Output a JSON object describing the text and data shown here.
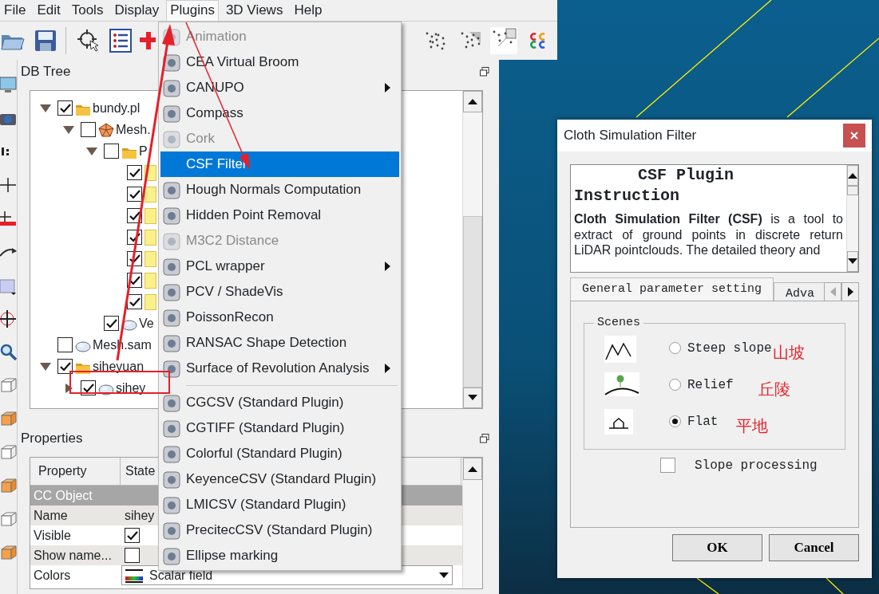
{
  "menubar": [
    {
      "label": "File",
      "selected": false
    },
    {
      "label": "Edit",
      "selected": false
    },
    {
      "label": "Tools",
      "selected": false
    },
    {
      "label": "Display",
      "selected": false
    },
    {
      "label": "Plugins",
      "selected": true
    },
    {
      "label": "3D Views",
      "selected": false
    },
    {
      "label": "Help",
      "selected": false
    }
  ],
  "db_tree": {
    "title": "DB Tree",
    "nodes": [
      {
        "label": "bundy.pl",
        "kind": "folder",
        "checked": true,
        "expanded": true,
        "children": [
          {
            "label": "Mesh.",
            "kind": "mesh",
            "checked": false,
            "expanded": true,
            "children": [
              {
                "label": "P",
                "kind": "folder",
                "checked": false,
                "expanded": true,
                "children": [
                  {
                    "kind": "note",
                    "checked": true
                  },
                  {
                    "kind": "note",
                    "checked": true
                  },
                  {
                    "kind": "note",
                    "checked": true
                  },
                  {
                    "kind": "note",
                    "checked": true
                  },
                  {
                    "kind": "note",
                    "checked": true
                  },
                  {
                    "kind": "note",
                    "checked": true
                  },
                  {
                    "kind": "note",
                    "checked": true
                  }
                ]
              },
              {
                "label": "Ve",
                "kind": "cloud",
                "checked": true
              }
            ]
          }
        ]
      },
      {
        "label": "Mesh.sam",
        "kind": "cloud",
        "checked": false
      },
      {
        "label": "siheyuan",
        "kind": "folder",
        "checked": true,
        "expanded": true,
        "children": [
          {
            "label": "sihey",
            "kind": "cloud",
            "checked": true,
            "expanded": false
          }
        ]
      }
    ]
  },
  "properties": {
    "title": "Properties",
    "columns": [
      "Property",
      "State"
    ],
    "rows": [
      {
        "kind": "group",
        "label": "CC Object"
      },
      {
        "kind": "text",
        "property": "Name",
        "value": "sihey"
      },
      {
        "kind": "checkbox",
        "property": "Visible",
        "checked": true
      },
      {
        "kind": "checkbox",
        "property": "Show name...",
        "checked": false
      },
      {
        "kind": "combo",
        "property": "Colors",
        "value": "Scalar field"
      }
    ]
  },
  "plugins_menu": [
    {
      "kind": "item",
      "label": "Animation",
      "disabled": true,
      "submenu": false,
      "selected": false,
      "icon": true
    },
    {
      "kind": "item",
      "label": "CEA Virtual Broom",
      "disabled": false,
      "submenu": false,
      "selected": false,
      "icon": true
    },
    {
      "kind": "item",
      "label": "CANUPO",
      "disabled": false,
      "submenu": true,
      "selected": false,
      "icon": true
    },
    {
      "kind": "item",
      "label": "Compass",
      "disabled": false,
      "submenu": false,
      "selected": false,
      "icon": true
    },
    {
      "kind": "item",
      "label": "Cork",
      "disabled": true,
      "submenu": false,
      "selected": false,
      "icon": true
    },
    {
      "kind": "item",
      "label": "CSF Filter",
      "disabled": false,
      "submenu": false,
      "selected": true,
      "icon": false
    },
    {
      "kind": "item",
      "label": "Hough Normals Computation",
      "disabled": false,
      "submenu": false,
      "selected": false,
      "icon": true
    },
    {
      "kind": "item",
      "label": "Hidden Point Removal",
      "disabled": false,
      "submenu": false,
      "selected": false,
      "icon": true
    },
    {
      "kind": "item",
      "label": "M3C2 Distance",
      "disabled": true,
      "submenu": false,
      "selected": false,
      "icon": true
    },
    {
      "kind": "item",
      "label": "PCL wrapper",
      "disabled": false,
      "submenu": true,
      "selected": false,
      "icon": true
    },
    {
      "kind": "item",
      "label": "PCV / ShadeVis",
      "disabled": false,
      "submenu": false,
      "selected": false,
      "icon": true
    },
    {
      "kind": "item",
      "label": "PoissonRecon",
      "disabled": false,
      "submenu": false,
      "selected": false,
      "icon": true
    },
    {
      "kind": "item",
      "label": "RANSAC Shape Detection",
      "disabled": false,
      "submenu": false,
      "selected": false,
      "icon": true
    },
    {
      "kind": "item",
      "label": "Surface of Revolution Analysis",
      "disabled": false,
      "submenu": true,
      "selected": false,
      "icon": true
    },
    {
      "kind": "separator"
    },
    {
      "kind": "item",
      "label": "CGCSV (Standard Plugin)",
      "disabled": false,
      "submenu": false,
      "selected": false,
      "icon": true
    },
    {
      "kind": "item",
      "label": "CGTIFF (Standard Plugin)",
      "disabled": false,
      "submenu": false,
      "selected": false,
      "icon": true
    },
    {
      "kind": "item",
      "label": "Colorful (Standard Plugin)",
      "disabled": false,
      "submenu": false,
      "selected": false,
      "icon": true
    },
    {
      "kind": "item",
      "label": "KeyenceCSV (Standard Plugin)",
      "disabled": false,
      "submenu": false,
      "selected": false,
      "icon": true
    },
    {
      "kind": "item",
      "label": "LMICSV (Standard Plugin)",
      "disabled": false,
      "submenu": false,
      "selected": false,
      "icon": true
    },
    {
      "kind": "item",
      "label": "PrecitecCSV (Standard Plugin)",
      "disabled": false,
      "submenu": false,
      "selected": false,
      "icon": true
    },
    {
      "kind": "item",
      "label": "Ellipse marking",
      "disabled": false,
      "submenu": false,
      "selected": false,
      "icon": true
    }
  ],
  "dialog": {
    "title": "Cloth Simulation Filter",
    "instruction": {
      "heading": "CSF Plugin",
      "subheading": "Instruction",
      "body": "**Cloth Simulation Filter (CSF)** is a tool to extract of ground points in discrete return LiDAR pointclouds. The detailed theory and"
    },
    "tabs": [
      {
        "label": "General parameter setting",
        "selected": true
      },
      {
        "label": "Adva",
        "selected": false
      }
    ],
    "scenes": {
      "title": "Scenes",
      "options": [
        {
          "kind": "steep",
          "label": "Steep slope",
          "note": "山坡",
          "selected": false
        },
        {
          "kind": "relief",
          "label": "Relief",
          "note": "丘陵",
          "selected": false
        },
        {
          "kind": "flat",
          "label": "Flat",
          "note": "平地",
          "selected": true
        }
      ]
    },
    "slope_processing": {
      "label": "Slope processing",
      "checked": false
    },
    "buttons": [
      {
        "label": "OK"
      },
      {
        "label": "Cancel"
      }
    ]
  }
}
